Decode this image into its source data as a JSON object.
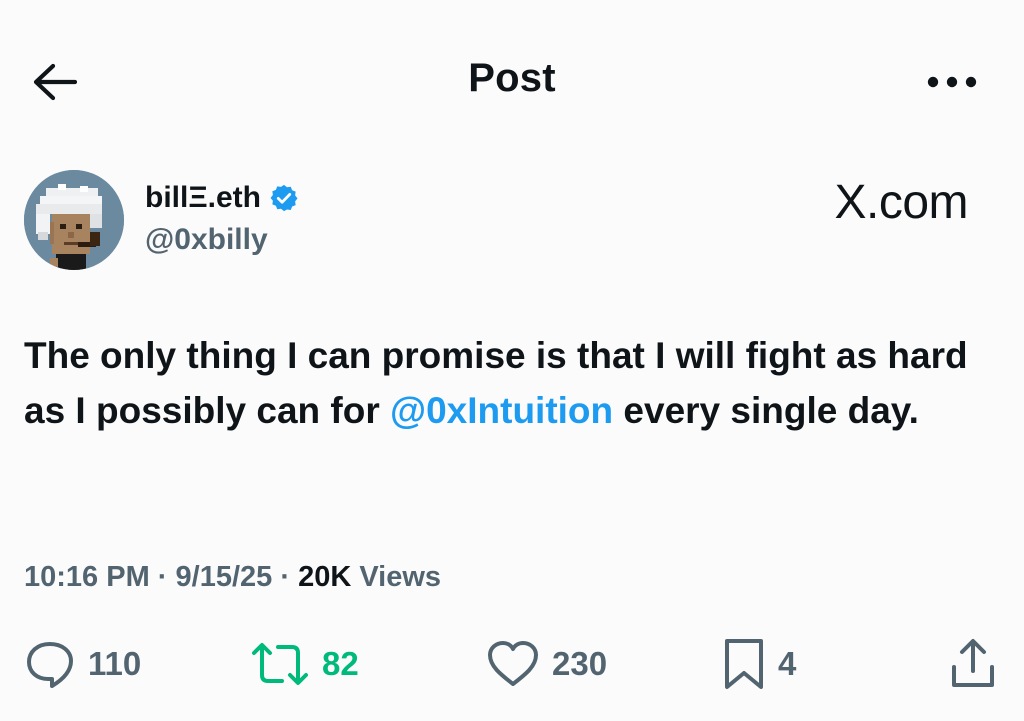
{
  "header": {
    "title": "Post",
    "back_icon": "arrow-left-icon",
    "more_icon": "more-horizontal-icon"
  },
  "author": {
    "display_name": "billΞ.eth",
    "handle": "@0xbilly",
    "verified": true,
    "avatar_icon": "pixel-art-avatar"
  },
  "brand": "X.com",
  "post": {
    "text_before": "The only thing I can promise is that I will fight as hard as I possibly can for ",
    "mention": "@0xIntuition",
    "text_after": " every single day."
  },
  "meta": {
    "time": "10:16 PM",
    "separator": " · ",
    "date": "9/15/25",
    "views_count": "20K",
    "views_label": " Views"
  },
  "actions": {
    "replies": "110",
    "reposts": "82",
    "likes": "230",
    "bookmarks": "4"
  },
  "colors": {
    "accent": "#1d9bf0",
    "repost": "#00ba7c",
    "secondary_text": "#536471",
    "primary_text": "#0f1419",
    "background": "#fbfbfb"
  }
}
